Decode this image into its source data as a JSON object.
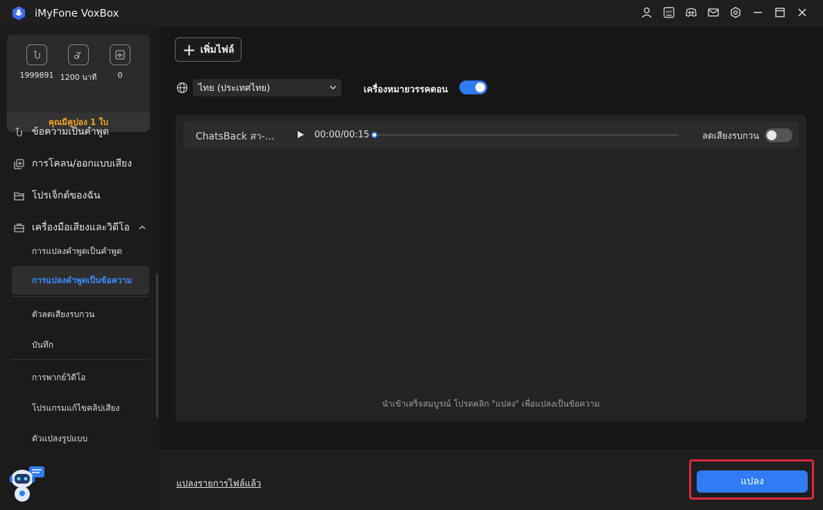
{
  "app": {
    "title": "iMyFone VoxBox"
  },
  "sidebar": {
    "stats": [
      {
        "icon": "text-to-speech-icon",
        "value": "1999891"
      },
      {
        "icon": "clock-text-icon",
        "value": "1200 นาที"
      },
      {
        "icon": "audio-wave-icon",
        "value": "0"
      }
    ],
    "coupon": "คุณมีคูปอง 1 ใบ",
    "nav": [
      {
        "label": "ข้อความเป็นคำพูด",
        "icon": "text-to-speech-icon"
      },
      {
        "label": "การโคลน/ออกแบบเสียง",
        "icon": "voice-clone-icon"
      },
      {
        "label": "โปรเจ็กต์ของฉัน",
        "icon": "folder-icon"
      },
      {
        "label": "เครื่องมือเสียงและวิดีโอ",
        "icon": "toolbox-icon"
      }
    ],
    "sub_items": [
      {
        "label": "การแปลงคำพูดเป็นคำพูด"
      },
      {
        "label": "การแปลงคำพูดเป็นข้อความ",
        "active": true
      },
      {
        "label": "ตัวลดเสียงรบกวน"
      },
      {
        "label": "บันทึก"
      },
      {
        "label": "การพากย์วิดีโอ"
      },
      {
        "label": "โปรแกรมแก้ไขคลิปเสียง"
      },
      {
        "label": "ตัวแปลงรูปแบบ"
      }
    ]
  },
  "main": {
    "add_file_label": "เพิ่มไฟล์",
    "language": "ไทย (ประเทศไทย)",
    "punctuation_label": "เครื่องหมายวรรคตอน",
    "punctuation_on": true,
    "file": {
      "name": "ChatsBack  สา-...",
      "time": "00:00/00:15",
      "progress": 0,
      "noise_reduction_label": "ลดเสียงรบกวน",
      "noise_reduction_on": false
    },
    "hint": "นำเข้าเสร็จสมบูรณ์ โปรดคลิก \"แปลง\" เพื่อแปลงเป็นข้อความ",
    "converted_files_link": "แปลงรายการไฟล์แล้ว",
    "convert_label": "แปลง"
  },
  "colors": {
    "accent": "#2f7cf6",
    "coupon": "#f5a623",
    "highlight": "#e0283a"
  }
}
